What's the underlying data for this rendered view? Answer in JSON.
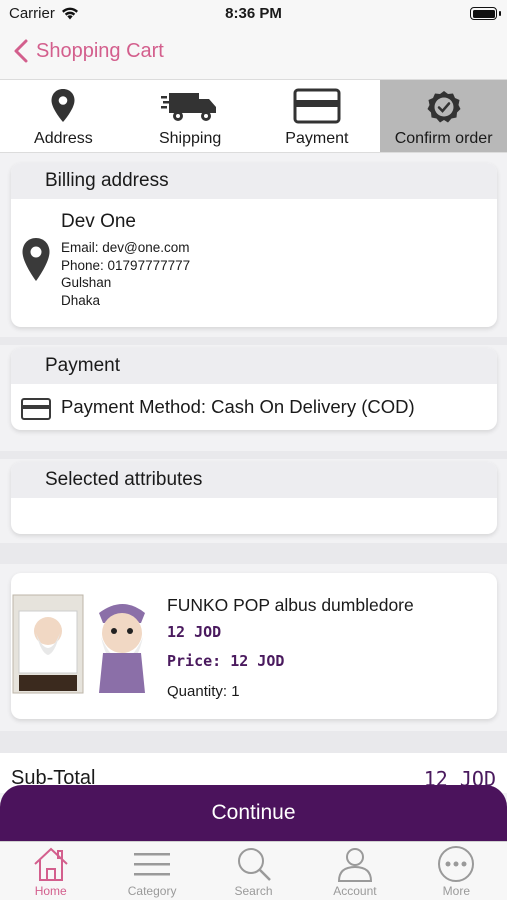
{
  "status_bar": {
    "carrier": "Carrier",
    "time": "8:36 PM"
  },
  "nav": {
    "back_label": "Shopping Cart"
  },
  "steps": [
    {
      "label": "Address",
      "icon": "map-pin-icon"
    },
    {
      "label": "Shipping",
      "icon": "truck-icon"
    },
    {
      "label": "Payment",
      "icon": "credit-card-icon"
    },
    {
      "label": "Confirm order",
      "icon": "check-badge-icon",
      "active": true
    }
  ],
  "billing": {
    "title": "Billing address",
    "name": "Dev One",
    "email": "Email: dev@one.com",
    "phone": "Phone: 01797777777",
    "area": "Gulshan",
    "city": "Dhaka"
  },
  "payment": {
    "title": "Payment",
    "method": "Payment Method: Cash On Delivery (COD)"
  },
  "attributes": {
    "title": "Selected attributes"
  },
  "product": {
    "name": "FUNKO POP albus dumbledore",
    "price": "12 JOD",
    "unit_price": "Price: 12 JOD",
    "quantity": "Quantity: 1"
  },
  "totals": {
    "subtotal_label": "Sub-Total",
    "subtotal_value": "12 JOD"
  },
  "continue_label": "Continue",
  "tabs": [
    {
      "label": "Home",
      "icon": "home-icon",
      "active": true
    },
    {
      "label": "Category",
      "icon": "menu-icon"
    },
    {
      "label": "Search",
      "icon": "search-icon"
    },
    {
      "label": "Account",
      "icon": "user-icon"
    },
    {
      "label": "More",
      "icon": "more-icon"
    }
  ],
  "colors": {
    "accent": "#d35f8d",
    "brand": "#4b135c",
    "price": "#4a1a5e"
  }
}
